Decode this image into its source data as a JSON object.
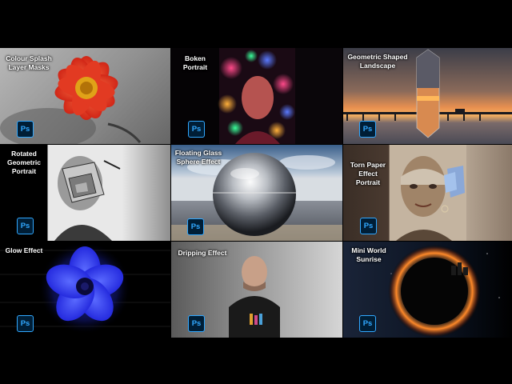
{
  "badge_text": "Ps",
  "tiles": [
    {
      "title": "Colour Splash\nLayer Masks"
    },
    {
      "title": "Boken\nPortrait"
    },
    {
      "title": "Geometric Shaped\nLandscape"
    },
    {
      "title": "Rotated\nGeometric\nPortrait"
    },
    {
      "title": "Floating Glass\nSphere Effect"
    },
    {
      "title": "Torn Paper\nEffect\nPortrait"
    },
    {
      "title": "Glow Effect"
    },
    {
      "title": "Dripping Effect"
    },
    {
      "title": "Mini World\nSunrise"
    }
  ],
  "colors": {
    "badge_bg": "#001e36",
    "badge_fg": "#31a8ff",
    "flower_red": "#e8321e",
    "glow_blue": "#2a3cff"
  },
  "icons": [
    "photoshop-logo-icon"
  ]
}
